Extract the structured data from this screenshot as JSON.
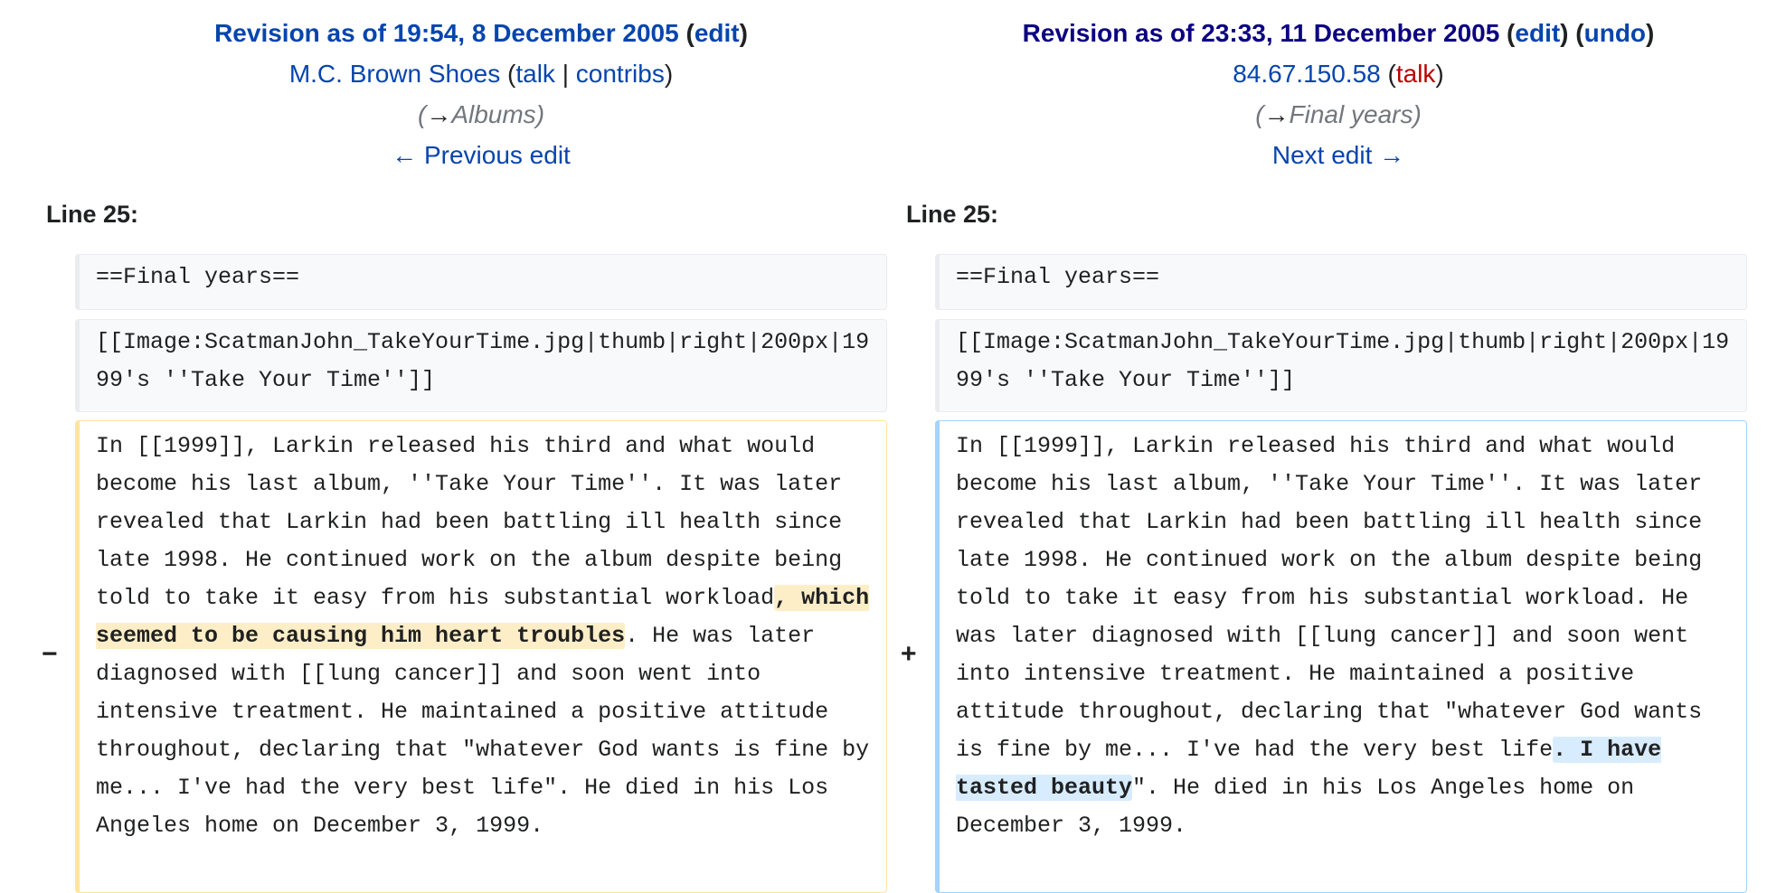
{
  "left": {
    "revision_label": "Revision as of 19:54, 8 December 2005",
    "edit": "edit",
    "user": "M.C. Brown Shoes",
    "talk": "talk",
    "sep": "|",
    "contribs": "contribs",
    "summary_arrow": "→",
    "summary_section": "Albums",
    "nav": "← Previous edit",
    "line_label": "Line 25:",
    "ctx1": "==Final years==",
    "ctx2": "[[Image:ScatmanJohn_TakeYourTime.jpg|thumb|right|200px|1999's ''Take Your Time'']]",
    "marker": "−",
    "text_before": "In [[1999]], Larkin released his third and what would become his last album, ''Take Your Time''. It was later revealed that Larkin had been battling ill health since late 1998. He continued work on the album despite being told to take it easy from his substantial workload",
    "text_highlight": ", which seemed to be causing him heart troubles",
    "text_after": ". He was later diagnosed with [[lung cancer]] and soon went into intensive treatment. He maintained a positive attitude throughout, declaring that \"whatever God wants is fine by me... I've had the very best life\". He died in his Los Angeles home on December 3, 1999."
  },
  "right": {
    "revision_label": "Revision as of 23:33, 11 December 2005",
    "edit": "edit",
    "undo": "undo",
    "user": "84.67.150.58",
    "talk": "talk",
    "summary_arrow": "→",
    "summary_section": "Final years",
    "nav": "Next edit →",
    "line_label": "Line 25:",
    "ctx1": "==Final years==",
    "ctx2": "[[Image:ScatmanJohn_TakeYourTime.jpg|thumb|right|200px|1999's ''Take Your Time'']]",
    "marker": "+",
    "text_before": "In [[1999]], Larkin released his third and what would become his last album, ''Take Your Time''. It was later revealed that Larkin had been battling ill health since late 1998. He continued work on the album despite being told to take it easy from his substantial workload. He was later diagnosed with [[lung cancer]] and soon went into intensive treatment. He maintained a positive attitude throughout, declaring that \"whatever God wants is fine by me... I've had the very best life",
    "text_highlight": ". I have tasted beauty",
    "text_after": "\". He died in his Los Angeles home on December 3, 1999."
  },
  "colors": {
    "link": "#0645ad",
    "visited_link": "#0b0080",
    "redlink": "#ba0000",
    "deleted_border": "#ffe49c",
    "deleted_highlight": "#feeec8",
    "added_border": "#a3d3ff",
    "added_highlight": "#d8ecff"
  }
}
